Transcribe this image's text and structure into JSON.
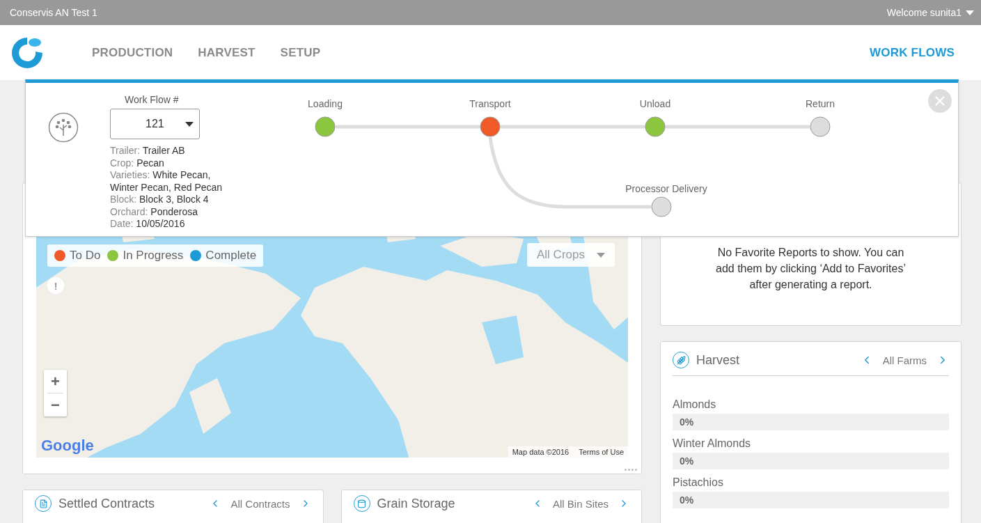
{
  "top_bar": {
    "title": "Conservis AN Test 1",
    "user_menu": "Welcome sunita1"
  },
  "nav": {
    "items": [
      {
        "label": "PRODUCTION",
        "selected": false
      },
      {
        "label": "HARVEST",
        "selected": false
      },
      {
        "label": "SETUP",
        "selected": false
      }
    ],
    "right_link": {
      "label": "WORK FLOWS",
      "selected": true
    }
  },
  "workflow_panel": {
    "number_label": "Work Flow #",
    "number": "121",
    "details": [
      {
        "label": "Trailer:",
        "value": "Trailer AB"
      },
      {
        "label": "Crop:",
        "value": "Pecan"
      },
      {
        "label": "Varieties:",
        "value": "White Pecan, Winter Pecan, Red Pecan"
      },
      {
        "label": "Block:",
        "value": "Block 3, Block 4"
      },
      {
        "label": "Orchard:",
        "value": "Ponderosa"
      },
      {
        "label": "Date:",
        "value": "10/05/2016"
      }
    ],
    "steps": [
      {
        "label": "Loading",
        "color": "#8cc63f",
        "kind": "main"
      },
      {
        "label": "Transport",
        "color": "#f05a28",
        "kind": "main"
      },
      {
        "label": "Unload",
        "color": "#8cc63f",
        "kind": "main"
      },
      {
        "label": "Return",
        "color": "#dddddd",
        "kind": "main"
      },
      {
        "label": "Processor Delivery",
        "color": "#dddddd",
        "kind": "branch"
      }
    ]
  },
  "map_card": {
    "legend": [
      {
        "label": "To Do",
        "color": "#f05a28"
      },
      {
        "label": "In Progress",
        "color": "#8cc63f"
      },
      {
        "label": "Complete",
        "color": "#1e9ad6"
      }
    ],
    "crop_filter": "All Crops",
    "alert": "!",
    "zoom_in": "+",
    "zoom_out": "−",
    "google": "Google",
    "map_data": "Map data ©2016",
    "terms": "Terms of Use"
  },
  "favorites_card": {
    "message": "No Favorite Reports to show. You can add them by clicking ‘Add to Favorites’ after generating a report."
  },
  "harvest_card": {
    "title": "Harvest",
    "filter": "All Farms",
    "rows": [
      {
        "label": "Almonds",
        "level": 0,
        "reading": "0%"
      },
      {
        "label": "Winter Almonds",
        "level": 0,
        "reading": "0%"
      },
      {
        "label": "Pistachios",
        "level": 0,
        "reading": "0%"
      }
    ]
  },
  "bottom_cards": [
    {
      "title": "Settled Contracts",
      "filter": "All Contracts",
      "kind": "contracts"
    },
    {
      "title": "Grain Storage",
      "filter": "All Bin Sites",
      "kind": "storage"
    }
  ]
}
